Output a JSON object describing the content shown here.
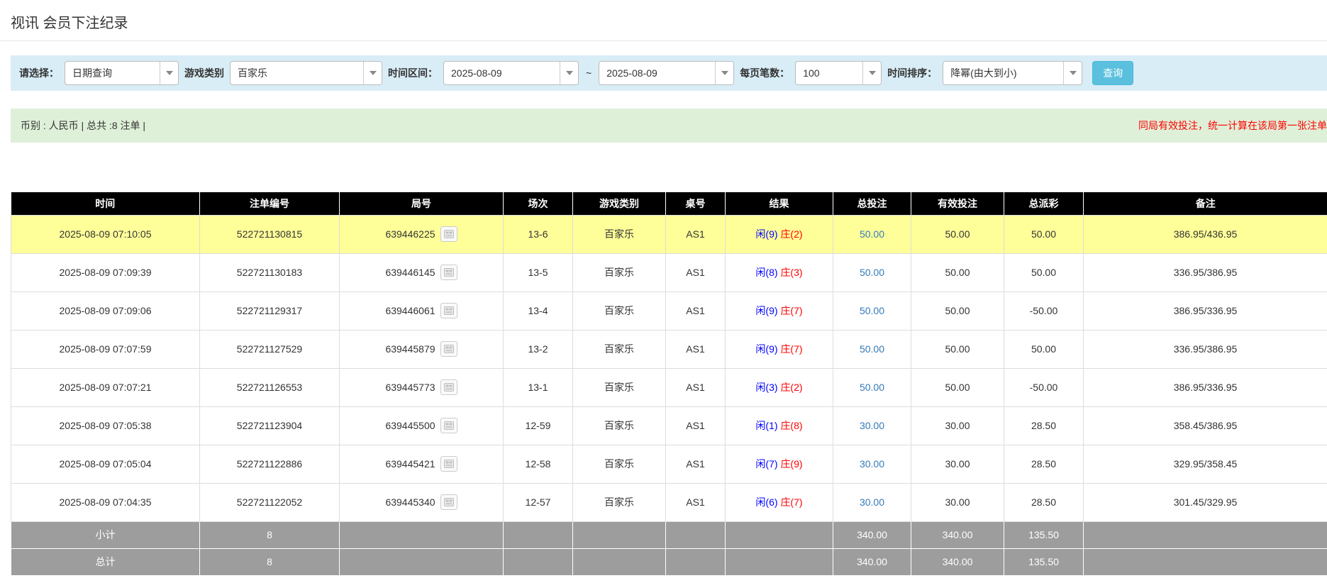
{
  "page": {
    "title": "视讯 会员下注纪录"
  },
  "filters": {
    "select_label": "请选择：",
    "select_value": "日期查询",
    "game_label": "游戏类别",
    "game_value": "百家乐",
    "range_label": "时间区间：",
    "date_from": "2025-08-09",
    "range_separator": "~",
    "date_to": "2025-08-09",
    "per_page_label": "每页笔数：",
    "per_page_value": "100",
    "sort_label": "时间排序：",
    "sort_value": "降幂(由大到小)",
    "search_button": "查询"
  },
  "summary_bar": {
    "left": "币别 : 人民币 | 总共 :8 注单 |",
    "right_notice": "同局有效投注，统一计算在该局第一张注单"
  },
  "table": {
    "headers": [
      "时间",
      "注单编号",
      "局号",
      "场次",
      "游戏类别",
      "桌号",
      "结果",
      "总投注",
      "有效投注",
      "总派彩",
      "备注"
    ],
    "rows": [
      {
        "time": "2025-08-09 07:10:05",
        "bet_id": "522721130815",
        "round": "639446225",
        "session": "13-6",
        "game": "百家乐",
        "table_no": "AS1",
        "result_player": "闲(9)",
        "result_banker": "庄(2)",
        "total_bet": "50.00",
        "valid_bet": "50.00",
        "payout": "50.00",
        "note": "386.95/436.95",
        "highlight": true
      },
      {
        "time": "2025-08-09 07:09:39",
        "bet_id": "522721130183",
        "round": "639446145",
        "session": "13-5",
        "game": "百家乐",
        "table_no": "AS1",
        "result_player": "闲(8)",
        "result_banker": "庄(3)",
        "total_bet": "50.00",
        "valid_bet": "50.00",
        "payout": "50.00",
        "note": "336.95/386.95",
        "highlight": false
      },
      {
        "time": "2025-08-09 07:09:06",
        "bet_id": "522721129317",
        "round": "639446061",
        "session": "13-4",
        "game": "百家乐",
        "table_no": "AS1",
        "result_player": "闲(9)",
        "result_banker": "庄(7)",
        "total_bet": "50.00",
        "valid_bet": "50.00",
        "payout": "-50.00",
        "note": "386.95/336.95",
        "highlight": false
      },
      {
        "time": "2025-08-09 07:07:59",
        "bet_id": "522721127529",
        "round": "639445879",
        "session": "13-2",
        "game": "百家乐",
        "table_no": "AS1",
        "result_player": "闲(9)",
        "result_banker": "庄(7)",
        "total_bet": "50.00",
        "valid_bet": "50.00",
        "payout": "50.00",
        "note": "336.95/386.95",
        "highlight": false
      },
      {
        "time": "2025-08-09 07:07:21",
        "bet_id": "522721126553",
        "round": "639445773",
        "session": "13-1",
        "game": "百家乐",
        "table_no": "AS1",
        "result_player": "闲(3)",
        "result_banker": "庄(2)",
        "total_bet": "50.00",
        "valid_bet": "50.00",
        "payout": "-50.00",
        "note": "386.95/336.95",
        "highlight": false
      },
      {
        "time": "2025-08-09 07:05:38",
        "bet_id": "522721123904",
        "round": "639445500",
        "session": "12-59",
        "game": "百家乐",
        "table_no": "AS1",
        "result_player": "闲(1)",
        "result_banker": "庄(8)",
        "total_bet": "30.00",
        "valid_bet": "30.00",
        "payout": "28.50",
        "note": "358.45/386.95",
        "highlight": false
      },
      {
        "time": "2025-08-09 07:05:04",
        "bet_id": "522721122886",
        "round": "639445421",
        "session": "12-58",
        "game": "百家乐",
        "table_no": "AS1",
        "result_player": "闲(7)",
        "result_banker": "庄(9)",
        "total_bet": "30.00",
        "valid_bet": "30.00",
        "payout": "28.50",
        "note": "329.95/358.45",
        "highlight": false
      },
      {
        "time": "2025-08-09 07:04:35",
        "bet_id": "522721122052",
        "round": "639445340",
        "session": "12-57",
        "game": "百家乐",
        "table_no": "AS1",
        "result_player": "闲(6)",
        "result_banker": "庄(7)",
        "total_bet": "30.00",
        "valid_bet": "30.00",
        "payout": "28.50",
        "note": "301.45/329.95",
        "highlight": false
      }
    ],
    "footer": [
      {
        "label": "小计",
        "count": "8",
        "total_bet": "340.00",
        "valid_bet": "340.00",
        "payout": "135.50"
      },
      {
        "label": "总计",
        "count": "8",
        "total_bet": "340.00",
        "valid_bet": "340.00",
        "payout": "135.50"
      }
    ]
  },
  "colors": {
    "filter_bar_bg": "#d9edf7",
    "summary_bar_bg": "#dff0d8",
    "button_bg": "#5bc0de",
    "button_border": "#46b8da",
    "header_bg": "#000000",
    "highlight_row_bg": "#ffff99",
    "footer_row_bg": "#9d9d9d",
    "link_blue": "#337ab7",
    "player_blue": "#0000ff",
    "banker_red": "#ff0000",
    "negative_red": "#ff0000",
    "notice_red": "#ff0000"
  }
}
